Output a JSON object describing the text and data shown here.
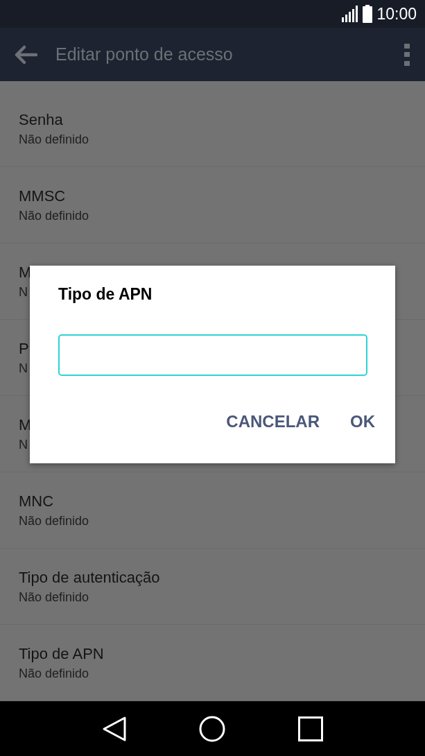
{
  "status_bar": {
    "time": "10:00"
  },
  "app_bar": {
    "title": "Editar ponto de acesso"
  },
  "settings": [
    {
      "title": "Senha",
      "value": "Não definido"
    },
    {
      "title": "MMSC",
      "value": "Não definido"
    },
    {
      "title": "M",
      "value": "N"
    },
    {
      "title": "P",
      "value": "N"
    },
    {
      "title": "M",
      "value": "N"
    },
    {
      "title": "MNC",
      "value": "Não definido"
    },
    {
      "title": "Tipo de autenticação",
      "value": "Não definido"
    },
    {
      "title": "Tipo de APN",
      "value": "Não definido"
    }
  ],
  "dialog": {
    "title": "Tipo de APN",
    "buttons": [
      "CANCELAR",
      "OK"
    ]
  }
}
